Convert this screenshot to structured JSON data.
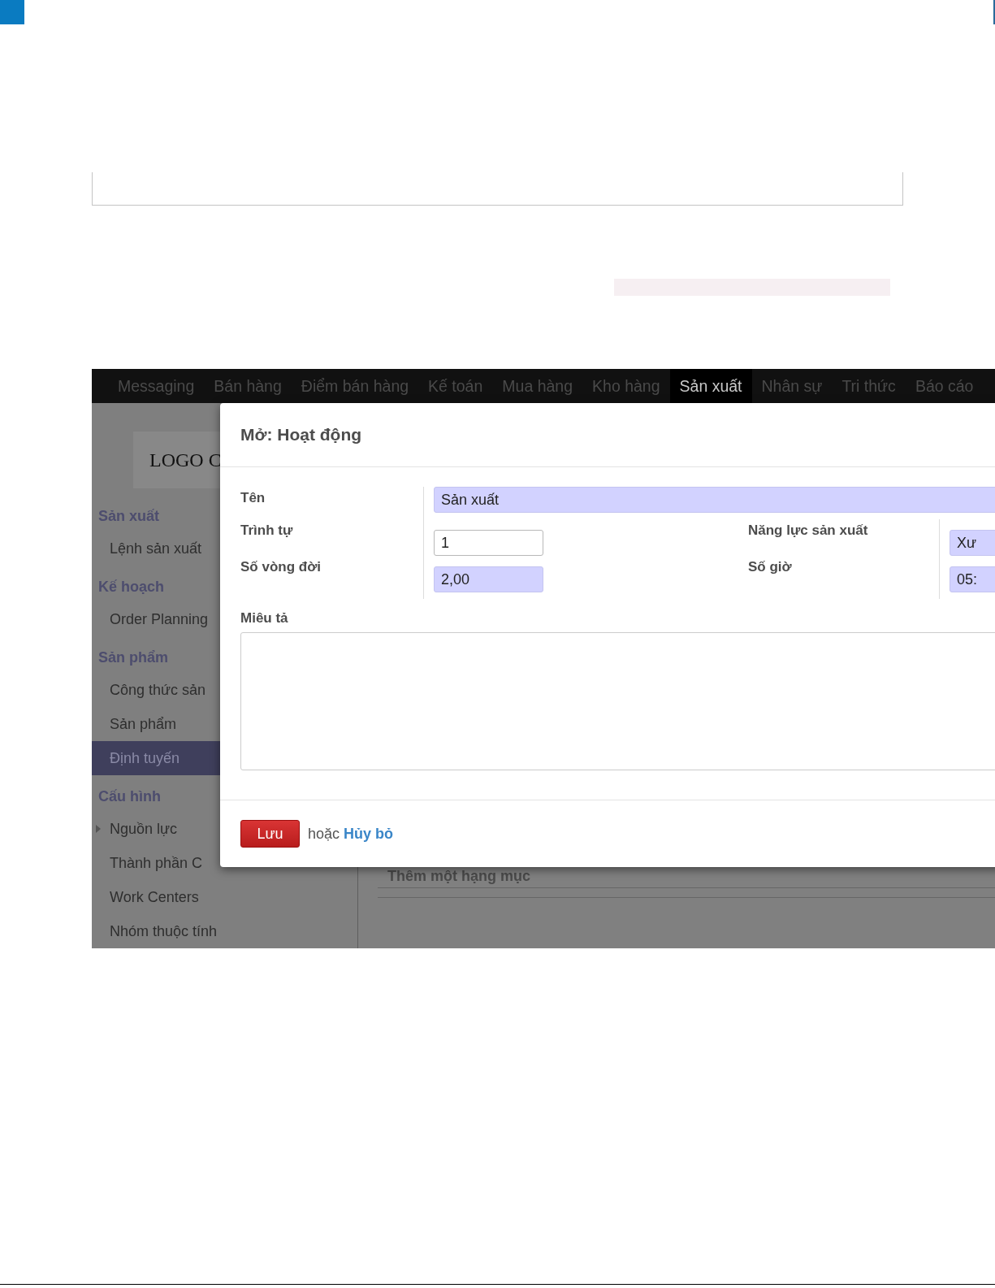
{
  "nav": [
    {
      "label": "Messaging",
      "selected": false
    },
    {
      "label": "Bán hàng",
      "selected": false
    },
    {
      "label": "Điểm bán hàng",
      "selected": false
    },
    {
      "label": "Kế toán",
      "selected": false
    },
    {
      "label": "Mua hàng",
      "selected": false
    },
    {
      "label": "Kho hàng",
      "selected": false
    },
    {
      "label": "Sản xuất",
      "selected": true
    },
    {
      "label": "Nhân sự",
      "selected": false
    },
    {
      "label": "Tri thức",
      "selected": false
    },
    {
      "label": "Báo cáo",
      "selected": false
    }
  ],
  "sidebar": {
    "logo": "LOGO C",
    "sections": [
      {
        "title": "Sản xuất",
        "items": [
          {
            "label": "Lệnh sản xuất",
            "kind": "link",
            "selected": false
          }
        ]
      },
      {
        "title": "Kế hoạch",
        "items": [
          {
            "label": "Order Planning",
            "kind": "link",
            "selected": false
          }
        ]
      },
      {
        "title": "Sản phẩm",
        "items": [
          {
            "label": "Công thức sản",
            "kind": "link",
            "selected": false
          },
          {
            "label": "Sản phẩm",
            "kind": "link",
            "selected": false
          },
          {
            "label": "Định tuyến",
            "kind": "link",
            "selected": true
          }
        ]
      },
      {
        "title": "Cấu hình",
        "items": [
          {
            "label": "Nguồn lực",
            "kind": "group",
            "selected": false
          },
          {
            "label": "Thành phần C",
            "kind": "link",
            "selected": false
          },
          {
            "label": "Work Centers",
            "kind": "link",
            "selected": false
          },
          {
            "label": "Nhóm thuộc tính",
            "kind": "link",
            "selected": false
          }
        ]
      }
    ]
  },
  "main": {
    "add_line": "Thêm một hạng mục"
  },
  "dialog": {
    "title": "Mở: Hoạt động",
    "name_field": {
      "label": "Tên",
      "value": "Sản xuất",
      "required": true
    },
    "left_fields": [
      {
        "label": "Trình tự",
        "value": "1",
        "required": false
      },
      {
        "label": "Số vòng đời",
        "value": "2,00",
        "required": true
      }
    ],
    "right_fields": [
      {
        "label": "Năng lực sản xuất",
        "value": "Xư",
        "required": true
      },
      {
        "label": "Số giờ",
        "value": "05:",
        "required": true
      }
    ],
    "description_label": "Miêu tả",
    "save_button": "Lưu",
    "or_text": "hoặc",
    "cancel_link": "Hủy bỏ"
  }
}
